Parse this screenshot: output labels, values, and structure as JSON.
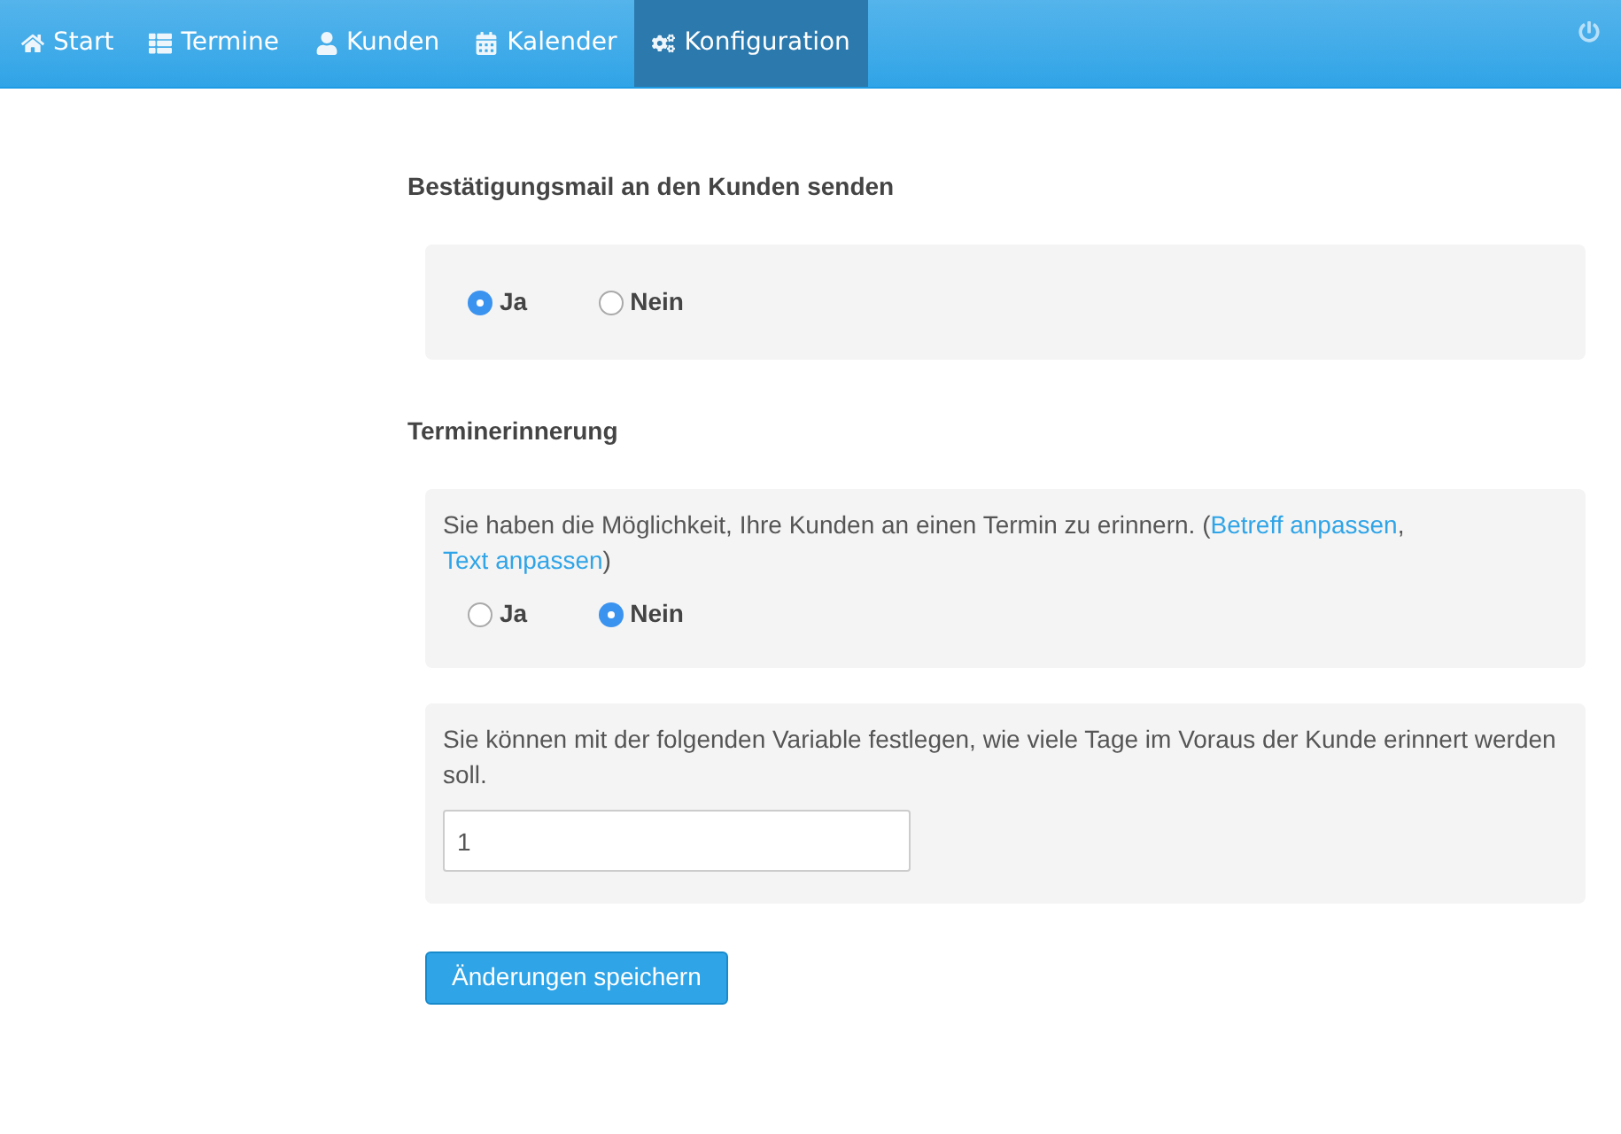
{
  "nav": {
    "items": [
      {
        "label": "Start",
        "selected": false
      },
      {
        "label": "Termine",
        "selected": false
      },
      {
        "label": "Kunden",
        "selected": false
      },
      {
        "label": "Kalender",
        "selected": false
      },
      {
        "label": "Konfiguration",
        "selected": true
      }
    ]
  },
  "sections": [
    {
      "title": "Bestätigungsmail an den Kunden senden",
      "panels": [
        {
          "kind": "radios",
          "options": [
            {
              "label": "Ja",
              "selected": true
            },
            {
              "label": "Nein",
              "selected": false
            }
          ]
        }
      ]
    },
    {
      "title": "Terminerinnerung",
      "panels": [
        {
          "kind": "radios",
          "text_parts": [
            {
              "kind": "text",
              "text": "Sie haben die Möglichkeit, Ihre Kunden an einen Termin zu erinnern. ("
            },
            {
              "kind": "link",
              "text": "Betreff anpassen"
            },
            {
              "kind": "text",
              "text": ", "
            },
            {
              "kind": "link",
              "text": "Text anpassen"
            },
            {
              "kind": "text",
              "text": ")"
            }
          ],
          "options": [
            {
              "label": "Ja",
              "selected": false
            },
            {
              "label": "Nein",
              "selected": true
            }
          ]
        },
        {
          "kind": "input",
          "text_parts": [
            {
              "kind": "text",
              "text": "Sie können mit der folgenden Variable festlegen, wie viele Tage im Voraus der Kunde erinnert werden soll."
            }
          ],
          "value": "1"
        }
      ]
    }
  ],
  "save_button": "Änderungen speichern"
}
